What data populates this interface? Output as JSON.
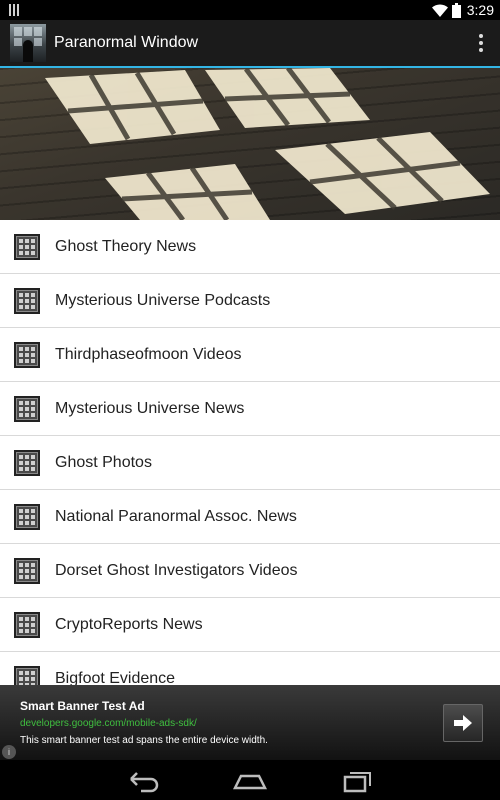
{
  "status_bar": {
    "time": "3:29"
  },
  "action_bar": {
    "title": "Paranormal Window"
  },
  "list": {
    "items": [
      {
        "label": "Ghost Theory News"
      },
      {
        "label": "Mysterious Universe Podcasts"
      },
      {
        "label": "Thirdphaseofmoon Videos"
      },
      {
        "label": "Mysterious Universe News"
      },
      {
        "label": "Ghost Photos"
      },
      {
        "label": "National Paranormal Assoc. News"
      },
      {
        "label": "Dorset Ghost Investigators Videos"
      },
      {
        "label": "CryptoReports News"
      },
      {
        "label": "Bigfoot Evidence"
      }
    ]
  },
  "ad": {
    "title": "Smart Banner Test Ad",
    "url": "developers.google.com/mobile-ads-sdk/",
    "description": "This smart banner test ad spans the entire device width.",
    "info_glyph": "i"
  },
  "colors": {
    "accent": "#33b5e5",
    "action_bar_bg": "#1b1b1b",
    "ad_url": "#3fbf3f"
  },
  "icons": {
    "list_item": "grid-window-icon",
    "overflow": "overflow-menu-icon",
    "ad_action": "arrow-right-icon"
  }
}
